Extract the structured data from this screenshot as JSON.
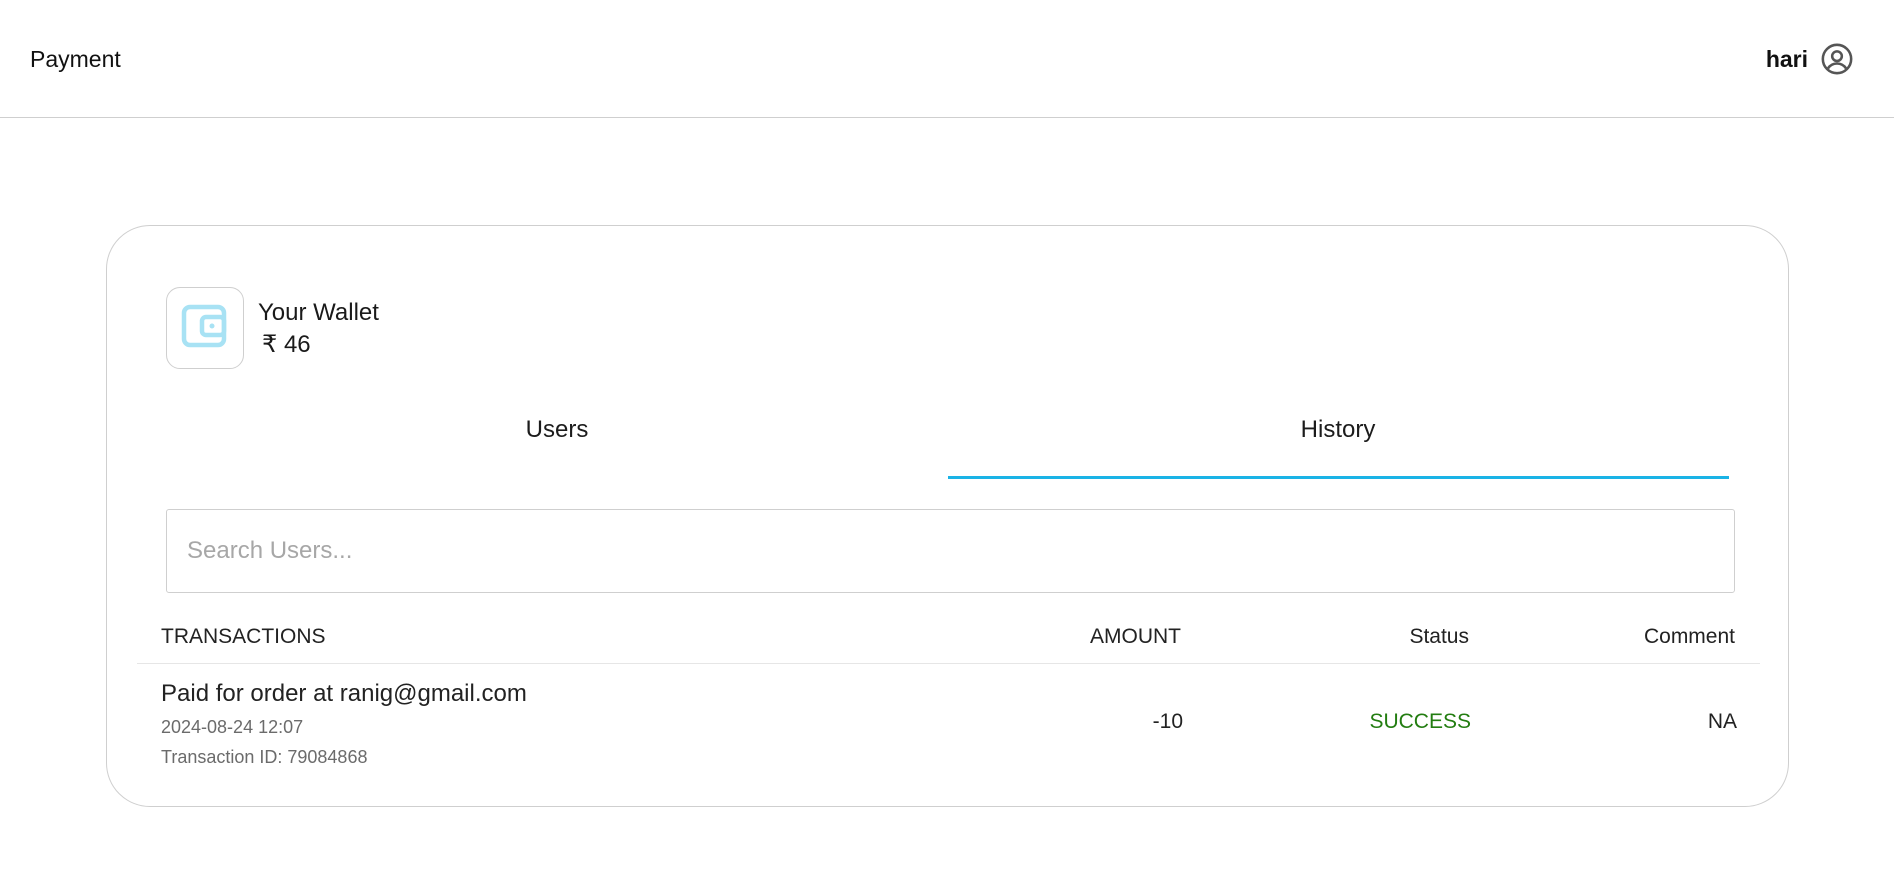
{
  "header": {
    "title": "Payment",
    "user_name": "hari",
    "avatar_icon": "account-circle-icon"
  },
  "wallet": {
    "icon": "wallet-icon",
    "title": "Your Wallet",
    "balance": "₹ 46"
  },
  "tabs": [
    {
      "label": "Users",
      "active": false
    },
    {
      "label": "History",
      "active": true
    }
  ],
  "search": {
    "placeholder": "Search Users...",
    "value": ""
  },
  "table": {
    "headers": {
      "transactions": "TRANSACTIONS",
      "amount": "AMOUNT",
      "status": "Status",
      "comment": "Comment"
    },
    "rows": [
      {
        "title": "Paid for order at ranig@gmail.com",
        "date": "2024-08-24 12:07",
        "transaction_id": "Transaction ID: 79084868",
        "amount": "-10",
        "status": "SUCCESS",
        "comment": "NA"
      }
    ]
  },
  "colors": {
    "accent": "#1ab3e6",
    "success": "#237d11",
    "wallet_icon": "#a8e2f4"
  }
}
